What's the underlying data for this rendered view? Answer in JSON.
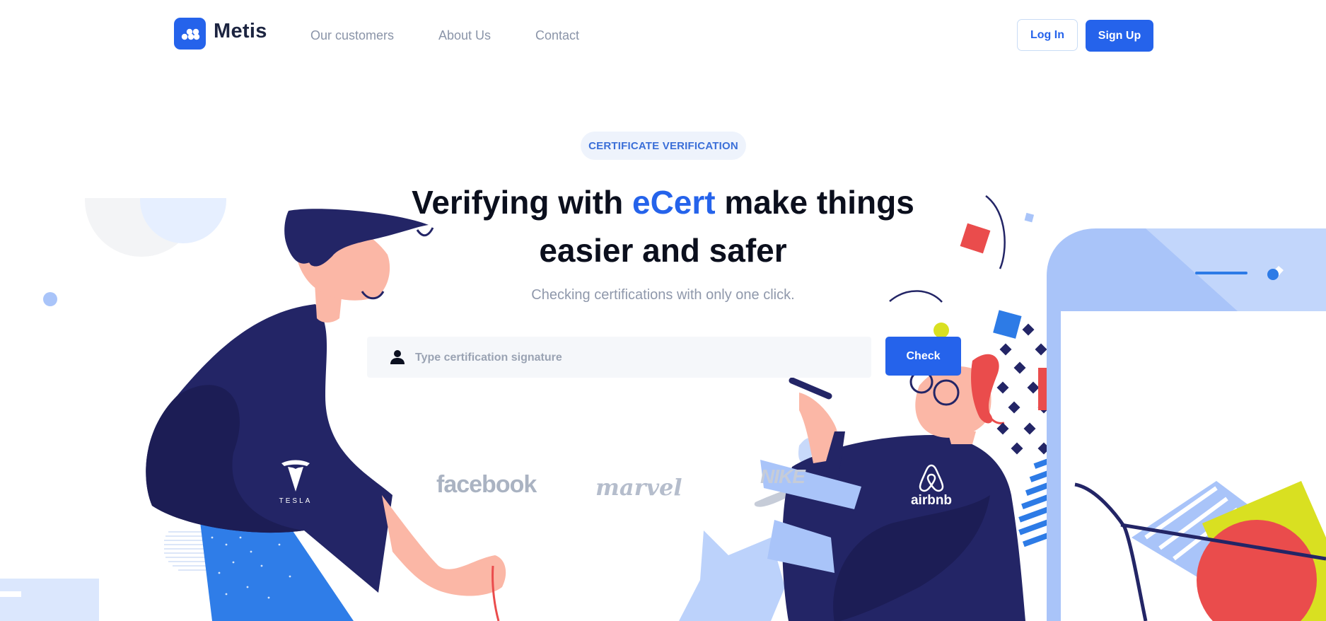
{
  "header": {
    "brand": "Metis",
    "nav": [
      {
        "label": "Our customers"
      },
      {
        "label": "About Us"
      },
      {
        "label": "Contact"
      }
    ],
    "login_label": "Log In",
    "signup_label": "Sign Up"
  },
  "hero": {
    "badge": "CERTIFICATE VERIFICATION",
    "headline_part1": "Verifying with ",
    "headline_accent": "eCert",
    "headline_part2": " make things easier and safer",
    "subheadline": "Checking certifications with only one click.",
    "search": {
      "placeholder": "Type certification signature",
      "value": ""
    },
    "check_label": "Check"
  },
  "brands": {
    "tesla": "TESLA",
    "facebook": "facebook",
    "marvel": "marvel",
    "nike": "NIKE",
    "airbnb": "airbnb"
  },
  "colors": {
    "accent": "#2563eb",
    "navy": "#232566",
    "light_blue": "#a9c4f9",
    "red": "#ea4c4c",
    "yellow": "#d9e021"
  },
  "icons": [
    "logo-icon",
    "user-icon",
    "tesla-logo-icon",
    "airbnb-logo-icon",
    "nike-swoosh-icon"
  ]
}
